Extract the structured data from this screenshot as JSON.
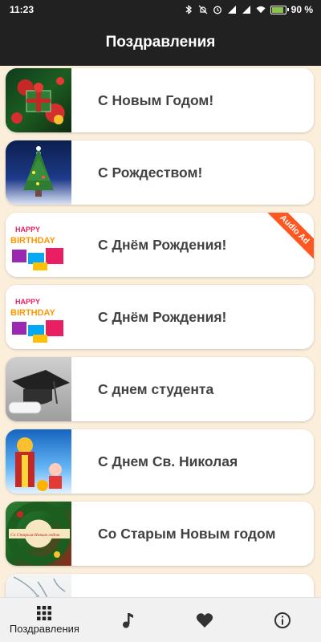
{
  "status_bar": {
    "time": "11:23",
    "battery_percent": "90 %",
    "icons": [
      "bluetooth-icon",
      "dnd-off-icon",
      "alarm-icon",
      "signal-icon",
      "signal-icon-2",
      "wifi-icon",
      "battery-icon"
    ]
  },
  "app_bar": {
    "title": "Поздравления"
  },
  "cards": [
    {
      "label": "С Новым Годом!",
      "thumb": "new-year-gifts-image"
    },
    {
      "label": "С Рождеством!",
      "thumb": "christmas-tree-image"
    },
    {
      "label": "С Днём Рождения!",
      "thumb": "birthday-gifts-image",
      "badge": "Audio Ad"
    },
    {
      "label": "С Днём Рождения!",
      "thumb": "birthday-gifts-image"
    },
    {
      "label": "С днем студента",
      "thumb": "graduation-cap-image"
    },
    {
      "label": "С Днем Св. Николая",
      "thumb": "saint-nicholas-image"
    },
    {
      "label": "Со Старым Новым годом",
      "thumb": "old-new-year-wreath-image"
    },
    {
      "label": "",
      "thumb": "winter-branches-image"
    }
  ],
  "thumb_text": {
    "birthday_line1": "HAPPY",
    "birthday_line2": "BIRTHDAY",
    "old_new_year_banner": "Со Старым Новым годом"
  },
  "bottom_nav": {
    "items": [
      {
        "label": "Поздравления",
        "icon": "grid-icon",
        "active": true
      },
      {
        "label": "",
        "icon": "music-note-icon",
        "active": false
      },
      {
        "label": "",
        "icon": "heart-icon",
        "active": false
      },
      {
        "label": "",
        "icon": "info-icon",
        "active": false
      }
    ]
  },
  "colors": {
    "app_bar": "#212121",
    "background": "#fbefdc",
    "card": "#ffffff",
    "badge": "#ff5722",
    "label_text": "#424242"
  }
}
